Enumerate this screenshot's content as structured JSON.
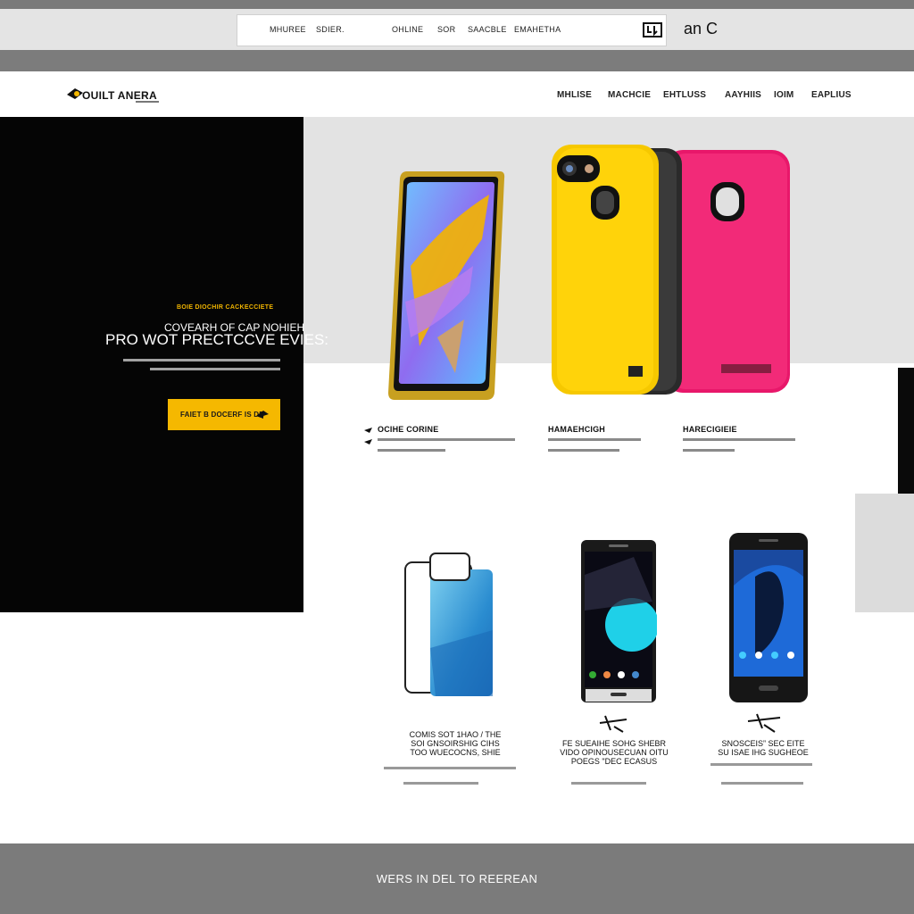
{
  "browser": {
    "tabs": [
      "MHUREE",
      "SDIER.",
      "OHLINE",
      "SOR",
      "SAACBLE",
      "EMAHETHA"
    ],
    "extra": "an C"
  },
  "header": {
    "logo_text": "OUILT ANERA",
    "nav": [
      "MHLISE",
      "MACHCIE",
      "EHTLUSS",
      "AAYHIIS",
      "IOIM",
      "EAPLIUS"
    ]
  },
  "hero": {
    "kicker": "BOIE DIOCHIR CACKECCIETE",
    "title_line1": "COVEARH OF CAP NOHIEH",
    "title_line2": "PRO WOT PRECTCCVE EVIES:",
    "cta_label": "FAIET B DOCERF IS DE"
  },
  "products_top": [
    {
      "title": "OCIHE CORINE"
    },
    {
      "title": "HAMAEHCIGH"
    },
    {
      "title": "HARECIGIEIE"
    }
  ],
  "products_bottom": [
    {
      "title_lines": [
        "COMIS SOT 1HAO / THE",
        "SOI GNSOIRSHIG CIHS",
        "TOO WUECOCNS, SHIE"
      ]
    },
    {
      "title_lines": [
        "FE SUEAIHE SOHG SHEBR",
        "VIDO OPINOUSECUAN OITU",
        "POEGS \"DEC ECASUS"
      ]
    },
    {
      "title_lines": [
        "SNOSCEIS” SEC EITE",
        "SU ISAE IHG SUGHEOE"
      ]
    }
  ],
  "footer": {
    "text": "WERS IN DEL TO REEREAN"
  },
  "colors": {
    "accent": "#f5b800",
    "hero_bg": "#050505",
    "footer_bg": "#7b7b7b"
  }
}
